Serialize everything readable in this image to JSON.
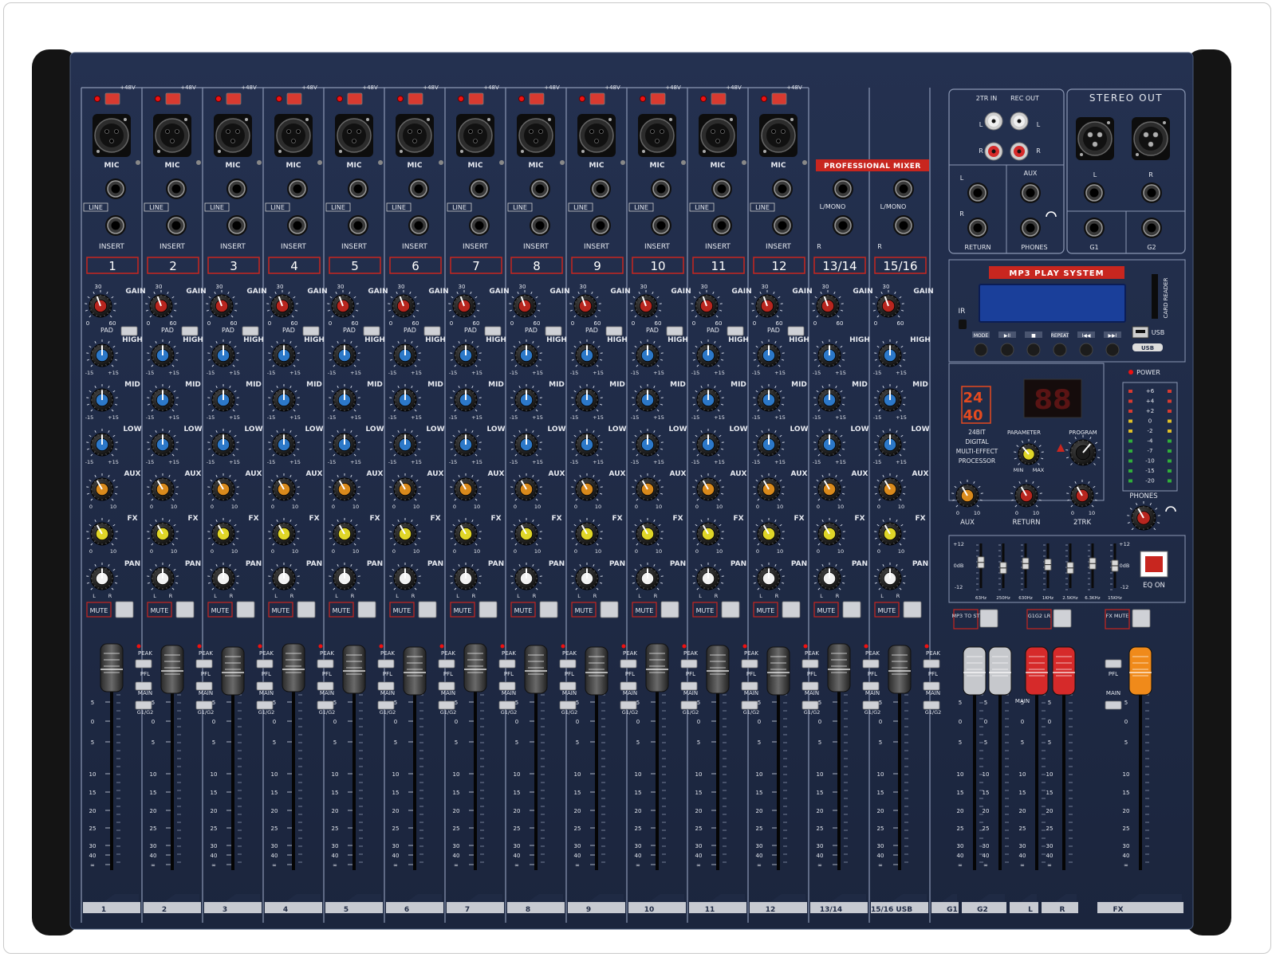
{
  "labels": {
    "phantom": "+48V",
    "mic": "MIC",
    "line": "LINE",
    "insert": "INSERT",
    "gain": "GAIN",
    "pad": "PAD",
    "high": "HIGH",
    "mid": "MID",
    "low": "LOW",
    "aux": "AUX",
    "fx": "FX",
    "pan": "PAN",
    "mute": "MUTE",
    "peak": "PEAK",
    "pfl": "PFL",
    "main": "MAIN",
    "g1g2": "G1/G2",
    "lmono": "L/MONO",
    "r": "R",
    "l": "L",
    "pan_l": "L",
    "pan_r": "R",
    "gain_min": "0",
    "gain_mid": "30",
    "gain_max": "60",
    "eq_min": "-15",
    "eq_max": "+15",
    "send_min": "0",
    "send_max": "10"
  },
  "brand": "PROFESSIONAL MIXER",
  "mono_channels": [
    "1",
    "2",
    "3",
    "4",
    "5",
    "6",
    "7",
    "8",
    "9",
    "10",
    "11",
    "12"
  ],
  "stereo_channels": [
    "13/14",
    "15/16"
  ],
  "fader_scale": [
    "5",
    "0",
    "5",
    "10",
    "15",
    "20",
    "25",
    "30",
    "40",
    "∞"
  ],
  "bottom_strip_labels": [
    "1",
    "2",
    "3",
    "4",
    "5",
    "6",
    "7",
    "8",
    "9",
    "10",
    "11",
    "12",
    "13/14",
    "15/16 USB",
    "G1",
    "G2",
    "L",
    "R",
    "FX"
  ],
  "io": {
    "tr_in": "2TR IN",
    "rec_out": "REC OUT",
    "stereo_out": "STEREO OUT",
    "aux": "AUX",
    "return": "RETURN",
    "phones": "PHONES",
    "g1": "G1",
    "g2": "G2",
    "l": "L",
    "r": "R"
  },
  "mp3": {
    "title": "MP3 PLAY SYSTEM",
    "ir": "IR",
    "card_reader": "CARD READER",
    "usb": "USB",
    "buttons": [
      "MODE",
      "▶II",
      "■",
      "REPEAT",
      "I◀◀",
      "▶▶I"
    ]
  },
  "dsp": {
    "badge_top": "24",
    "badge_bottom": "40",
    "desc": [
      "24BIT",
      "DIGITAL",
      "MULTI-EFFECT",
      "PROCESSOR"
    ],
    "display": "88",
    "parameter": "PARAMETER",
    "program": "PROGRAM",
    "min": "MIN",
    "max": "MAX"
  },
  "master": {
    "aux": "AUX",
    "return": "RETURN",
    "tr": "2TRK",
    "phones": "PHONES",
    "power": "POWER",
    "knob_min": "0",
    "knob_max": "10",
    "meter": [
      "+6",
      "+4",
      "+2",
      "0",
      "-2",
      "-4",
      "-7",
      "-10",
      "-15",
      "-20"
    ]
  },
  "eq": {
    "plus": "+12",
    "zero": "0dB",
    "minus": "-12",
    "bands": [
      "63Hz",
      "250Hz",
      "630Hz",
      "1KHz",
      "2.5KHz",
      "6.3KHz",
      "15KHz"
    ],
    "eq_on": "EQ ON",
    "band_levels": [
      0.15,
      -0.1,
      0.1,
      0.05,
      -0.1,
      0.1,
      0.0
    ]
  },
  "group_buttons": [
    "MP3 TO ST",
    "G1G2 LR",
    "FX MUTE"
  ],
  "colors": {
    "panel": "#1f2a44",
    "accent_red": "#c8261f",
    "gain_knob": "#b8261f",
    "eq_knob": "#2c78c8",
    "aux_knob": "#d98a1c",
    "fx_knob": "#e0d628",
    "lcd": "#1a3f9a"
  }
}
